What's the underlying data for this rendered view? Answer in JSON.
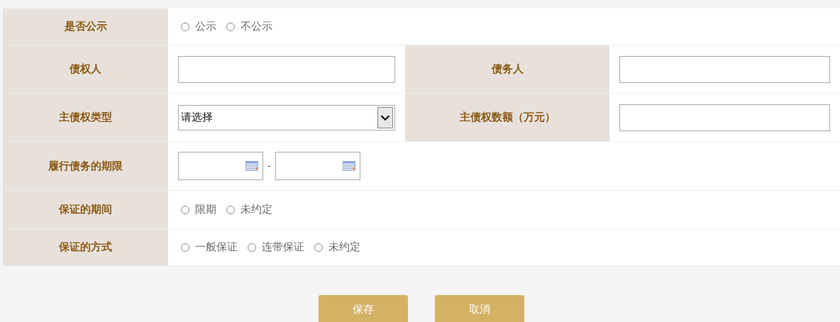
{
  "form": {
    "rows": [
      {
        "kind": "radios",
        "label": "是否公示",
        "options": [
          {
            "label": "公示",
            "selected": false
          },
          {
            "label": "不公示",
            "selected": false
          }
        ]
      },
      {
        "kind": "pair",
        "label": "债权人",
        "field": {
          "kind": "text"
        },
        "right_label": "债务人",
        "right_field": {
          "kind": "text"
        }
      },
      {
        "kind": "pair",
        "label": "主债权类型",
        "field": {
          "kind": "select",
          "value": "请选择"
        },
        "right_label": "主债权数额（万元）",
        "right_field": {
          "kind": "text"
        }
      },
      {
        "kind": "daterange",
        "label": "履行债务的期限",
        "separator": "-"
      },
      {
        "kind": "radios",
        "label": "保证的期间",
        "options": [
          {
            "label": "限期",
            "selected": false
          },
          {
            "label": "未约定",
            "selected": false
          }
        ]
      },
      {
        "kind": "radios",
        "label": "保证的方式",
        "options": [
          {
            "label": "一般保证",
            "selected": false
          },
          {
            "label": "连带保证",
            "selected": false
          },
          {
            "label": "未约定",
            "selected": false
          }
        ]
      }
    ]
  },
  "buttons": [
    "保存",
    "取消"
  ]
}
